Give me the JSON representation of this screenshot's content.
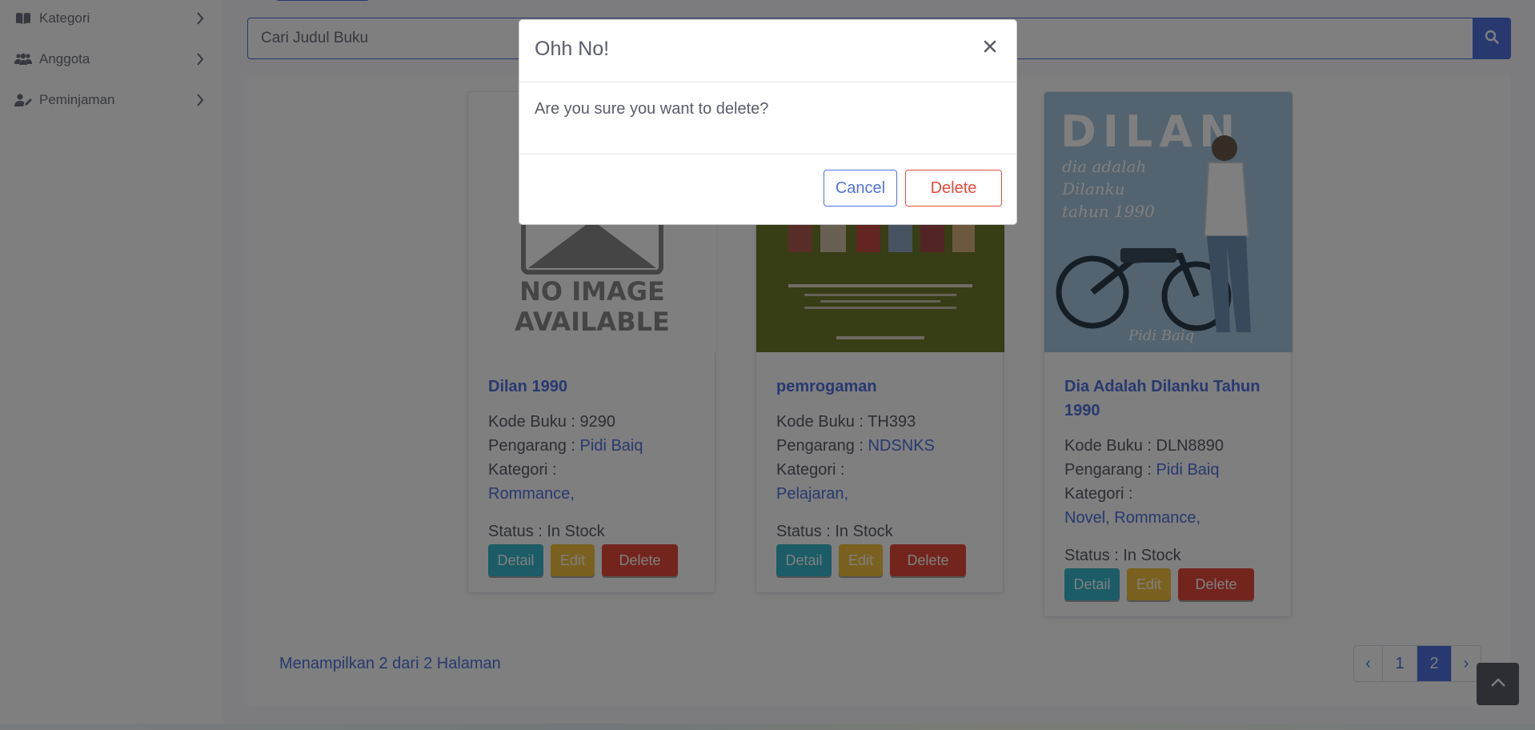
{
  "sidebar": {
    "items": [
      {
        "label": "Kategori",
        "icon": "book-open-icon"
      },
      {
        "label": "Anggota",
        "icon": "users-icon"
      },
      {
        "label": "Peminjaman",
        "icon": "user-edit-icon"
      }
    ]
  },
  "search": {
    "value": "Cari Judul Buku"
  },
  "labels": {
    "kode": "Kode Buku : ",
    "pengarang": "Pengarang : ",
    "kategori": "Kategori :",
    "status": "Status : "
  },
  "books": [
    {
      "title": "Dilan 1990",
      "kode": "9290",
      "pengarang": "Pidi Baiq",
      "kategori": "Rommance,",
      "status": "In Stock",
      "image_text_1": "NO IMAGE",
      "image_text_2": "AVAILABLE"
    },
    {
      "title": "pemrogaman",
      "kode": "TH393",
      "pengarang": "NDSNKS",
      "kategori": "Pelajaran,",
      "status": "In Stock"
    },
    {
      "title": "Dia Adalah Dilanku Tahun 1990",
      "kode": "DLN8890",
      "pengarang": "Pidi Baiq",
      "kategori": "Novel, Rommance,",
      "status": "In Stock",
      "cover_title": "DILAN",
      "cover_subtitle_1": "dia adalah",
      "cover_subtitle_2": "Dilanku",
      "cover_subtitle_3": "tahun 1990",
      "cover_author": "Pidi Baiq"
    }
  ],
  "card_buttons": {
    "detail": "Detail",
    "edit": "Edit",
    "delete": "Delete"
  },
  "footer": {
    "text": "Menampilkan 2 dari 2 Halaman"
  },
  "pagination": {
    "prev": "‹",
    "pages": [
      "1",
      "2"
    ],
    "current": "2",
    "next": "›"
  },
  "modal": {
    "title": "Ohh No!",
    "close": "×",
    "message": "Are you sure you want to delete?",
    "cancel": "Cancel",
    "delete": "Delete"
  },
  "colors": {
    "primary": "#4e73df",
    "info": "#36b9cc",
    "warning": "#f6c23e",
    "danger": "#e74a3b"
  }
}
